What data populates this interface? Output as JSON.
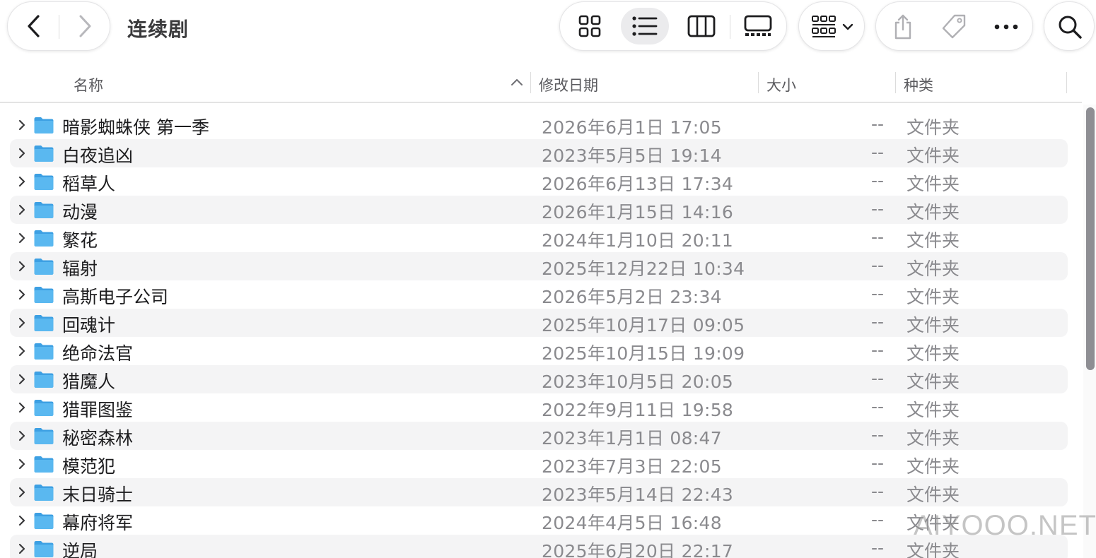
{
  "window": {
    "title": "连续剧"
  },
  "toolbar": {
    "back_icon": "chevron-left-icon",
    "forward_icon": "chevron-right-icon",
    "views": [
      "grid-view-icon",
      "list-view-icon",
      "column-view-icon",
      "gallery-view-icon"
    ],
    "active_view": "list",
    "group_icon": "group-by-icon",
    "actions": [
      "share-icon",
      "tag-icon",
      "more-icon"
    ],
    "search_icon": "search-icon"
  },
  "columns": {
    "name": "名称",
    "modified": "修改日期",
    "size": "大小",
    "kind": "种类",
    "sort": "ascending"
  },
  "files": [
    {
      "name": "暗影蜘蛛侠 第一季",
      "modified": "2026年6月1日 17:05",
      "size": "--",
      "kind": "文件夹"
    },
    {
      "name": "白夜追凶",
      "modified": "2023年5月5日 19:14",
      "size": "--",
      "kind": "文件夹"
    },
    {
      "name": "稻草人",
      "modified": "2026年6月13日 17:34",
      "size": "--",
      "kind": "文件夹"
    },
    {
      "name": "动漫",
      "modified": "2026年1月15日 14:16",
      "size": "--",
      "kind": "文件夹"
    },
    {
      "name": "繁花",
      "modified": "2024年1月10日 20:11",
      "size": "--",
      "kind": "文件夹"
    },
    {
      "name": "辐射",
      "modified": "2025年12月22日 10:34",
      "size": "--",
      "kind": "文件夹"
    },
    {
      "name": "高斯电子公司",
      "modified": "2026年5月2日 23:34",
      "size": "--",
      "kind": "文件夹"
    },
    {
      "name": "回魂计",
      "modified": "2025年10月17日 09:05",
      "size": "--",
      "kind": "文件夹"
    },
    {
      "name": "绝命法官",
      "modified": "2025年10月15日 19:09",
      "size": "--",
      "kind": "文件夹"
    },
    {
      "name": "猎魔人",
      "modified": "2023年10月5日 20:05",
      "size": "--",
      "kind": "文件夹"
    },
    {
      "name": "猎罪图鉴",
      "modified": "2022年9月11日 19:58",
      "size": "--",
      "kind": "文件夹"
    },
    {
      "name": "秘密森林",
      "modified": "2023年1月1日 08:47",
      "size": "--",
      "kind": "文件夹"
    },
    {
      "name": "模范犯",
      "modified": "2023年7月3日 22:05",
      "size": "--",
      "kind": "文件夹"
    },
    {
      "name": "末日骑士",
      "modified": "2023年5月14日 22:43",
      "size": "--",
      "kind": "文件夹"
    },
    {
      "name": "幕府将军",
      "modified": "2024年4月5日 16:48",
      "size": "--",
      "kind": "文件夹"
    },
    {
      "name": "逆局",
      "modified": "2025年6月20日 22:17",
      "size": "--",
      "kind": "文件夹"
    }
  ],
  "watermark": "AIYOOO.NET",
  "colors": {
    "folder": "#5ab8f0",
    "folder_dark": "#3da0e3",
    "row_alt": "#f4f4f5",
    "secondary_text": "#8a8a8e"
  }
}
